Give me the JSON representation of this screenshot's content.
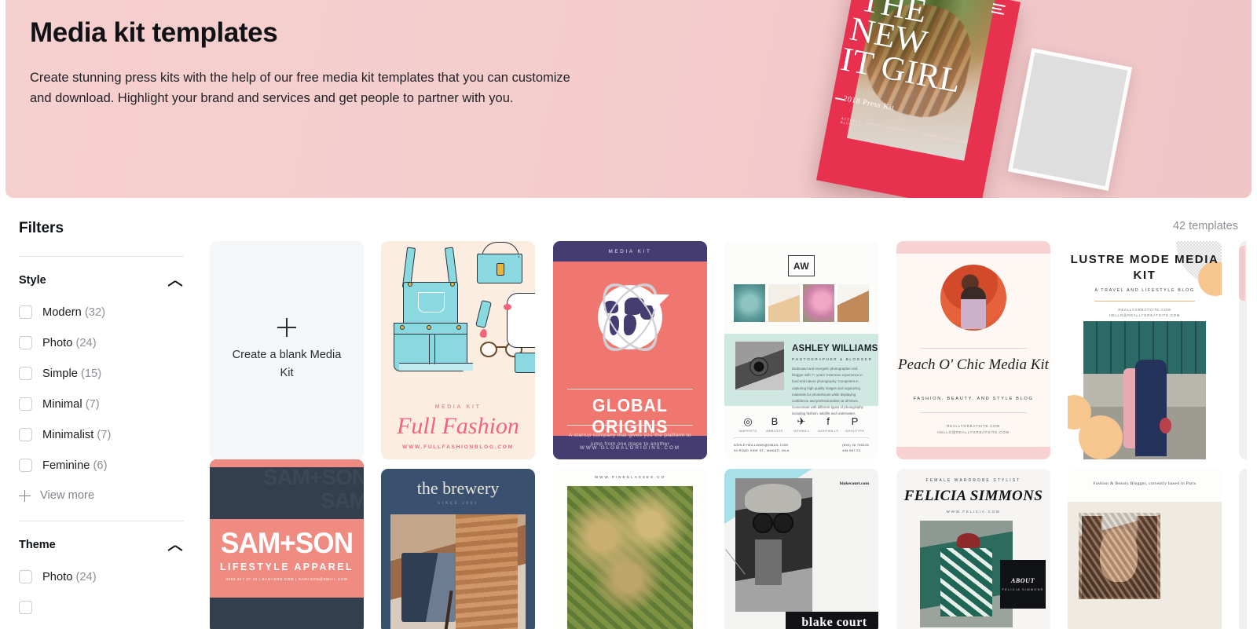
{
  "hero": {
    "title": "Media kit templates",
    "description": "Create stunning press kits with the help of our free media kit templates that you can customize and download. Highlight your brand and services and get people to partner with you.",
    "mockup": {
      "line1": "THE",
      "line2": "NEW",
      "line3": "IT GIRL",
      "press_kit": "2018 Press Kit",
      "tags": "ACTRESS · SINGER · SONGWRITER · BRAND AMBASSADOR · BLOGGER"
    },
    "background_color": "#f4cdcd",
    "accent_color": "#e8304f"
  },
  "sidebar": {
    "title": "Filters",
    "sections": [
      {
        "title": "Style",
        "expanded": true,
        "options": [
          {
            "label": "Modern",
            "count": "(32)"
          },
          {
            "label": "Photo",
            "count": "(24)"
          },
          {
            "label": "Simple",
            "count": "(15)"
          },
          {
            "label": "Minimal",
            "count": "(7)"
          },
          {
            "label": "Minimalist",
            "count": "(7)"
          },
          {
            "label": "Feminine",
            "count": "(6)"
          }
        ],
        "view_more": "View more"
      },
      {
        "title": "Theme",
        "expanded": true,
        "options": [
          {
            "label": "Photo",
            "count": "(24)"
          }
        ]
      }
    ]
  },
  "results": {
    "count_label": "42 templates",
    "blank_card": {
      "label": "Create a blank Media Kit"
    },
    "templates": [
      {
        "id": "full-fashion",
        "kicker": "MEDIA KIT",
        "name": "Full Fashion",
        "url": "WWW.FULLFASHIONBLOG.COM"
      },
      {
        "id": "global-origins",
        "kicker": "MEDIA KIT",
        "name": "GLOBAL ORIGINS",
        "description": "A startup company that gives you the platform to jump from one place to another",
        "url": "WWW.GLOBALORIGINS.COM"
      },
      {
        "id": "ashley-williams",
        "monogram": "AW",
        "name": "ASHLEY WILLIAMS",
        "role": "PHOTOGRAPHER & BLOGGER",
        "bio": "Dedicated and energetic photographer and blogger with 7+ years' extensive experience in food and nature photography. Competent in capturing high quality images and organizing materials for photoshoots while displaying confidence and professionalism at all times. Conversant with different types of photography including fashion, wildlife and underwater.",
        "social": [
          {
            "icon": "rss-icon",
            "glyph": "\u0001",
            "handle": "/AWPHOTO"
          },
          {
            "icon": "blogger-icon",
            "glyph": "B",
            "handle": "AWBLOGS"
          },
          {
            "icon": "twitter-icon",
            "glyph": "\u0001",
            "handle": "/ASHWILL"
          },
          {
            "icon": "facebook-icon",
            "glyph": "f",
            "handle": "/ASHYWILLS"
          },
          {
            "icon": "pinterest-icon",
            "glyph": "P",
            "handle": "/ASHLEYPH"
          }
        ],
        "email": "ASHLEYWILLIAMS@GMAIL.COM",
        "address": "34 ROAD SIDE ST., MAKATI, MLA",
        "phone": "(639) 36 755425",
        "phone2": "456 987 23"
      },
      {
        "id": "peach-o-chic",
        "name": "Peach O' Chic Media Kit",
        "subtitle": "FASHION, BEAUTY, AND STYLE BLOG",
        "url": "REALLYGREATSITE.COM",
        "email": "HELLO@REALLYGREATSITE.COM"
      },
      {
        "id": "lustre-mode",
        "name": "LUSTRE MODE MEDIA KIT",
        "subtitle": "A TRAVEL AND LIFESTYLE BLOG",
        "url": "REALLYGREATSITE.COM",
        "email": "HELLO@REALLYGREATSITE.COM"
      },
      {
        "id": "sam-son",
        "name": "SAM+SON",
        "tagline": "LIFESTYLE APPAREL",
        "contact": "0995 947 37 45 | SAM+SON.COM | SAM+SON@EMAIL.COM",
        "ghost1": "SAM+SON",
        "ghost2": "SAM"
      },
      {
        "id": "the-brewery",
        "name": "the brewery",
        "subtitle": "SINCE 2001"
      },
      {
        "id": "pine-glasses",
        "url": "WWW.PINEGLASSES.CO"
      },
      {
        "id": "blake-court",
        "name": "blake court",
        "url": "blakecourt.com"
      },
      {
        "id": "felicia-simmons",
        "role": "FEMALE WARDROBE STYLIST",
        "name": "FELICIA SIMMONS",
        "url": "WWW.FELICIA.COM",
        "about_title": "ABOUT",
        "about_sub": "FELICIA SIMMONS"
      },
      {
        "id": "paris-blogger",
        "tagline": "Fashion & Beauty Blogger, currently based in Paris"
      }
    ]
  }
}
